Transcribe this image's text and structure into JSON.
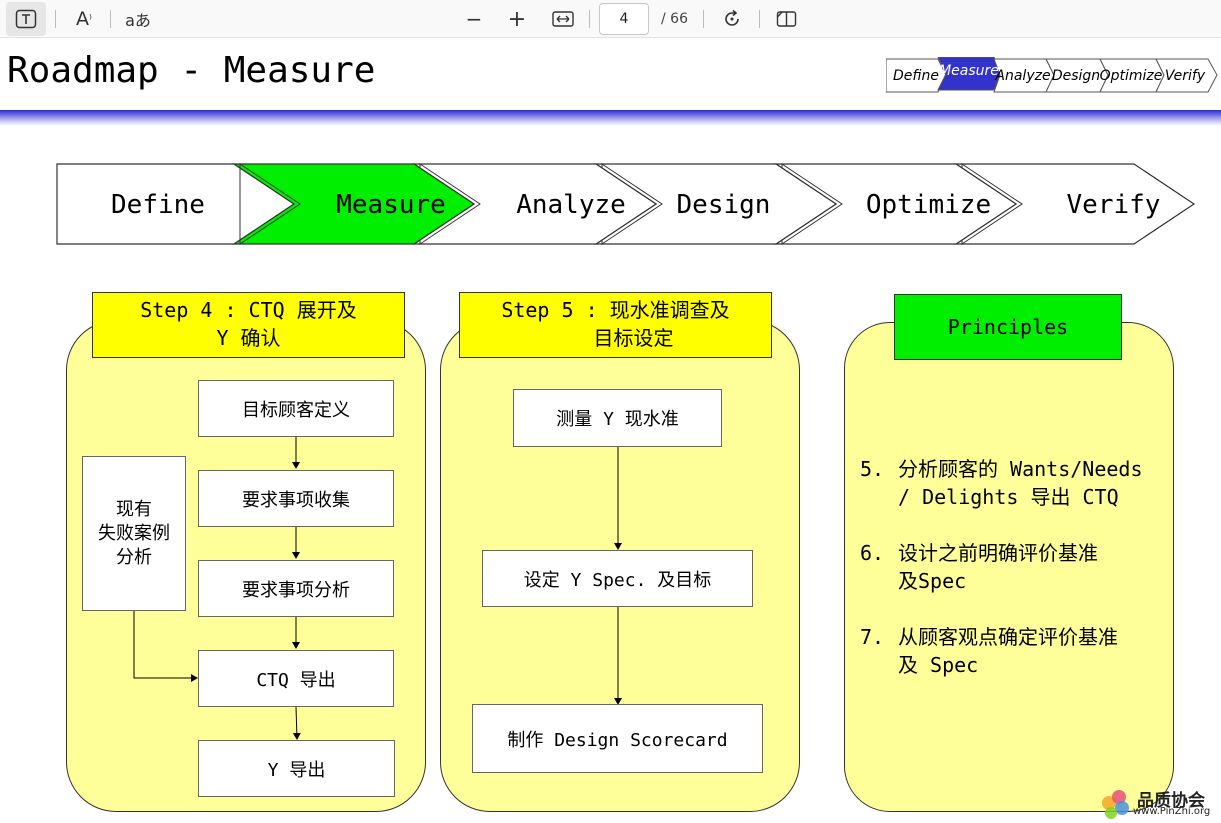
{
  "toolbar": {
    "text_tool_icon": "T",
    "read_aloud_icon": "A",
    "translate_icon": "aあ",
    "zoom_out_icon": "−",
    "zoom_in_icon": "+",
    "fit_width_icon": "↔",
    "current_page": "4",
    "total_pages": "/ 66",
    "rotate_icon": "rotate-icon",
    "two_page_icon": "page-view-icon"
  },
  "slide": {
    "title": "Roadmap - Measure",
    "mini_nav": [
      "Define",
      "Measure",
      "Analyze",
      "Design",
      "Optimize",
      "Verify"
    ],
    "big_nav": [
      "Define",
      "Measure",
      "Analyze",
      "Design",
      "Optimize",
      "Verify"
    ],
    "active_step": "Measure",
    "colors": {
      "active": "#00ee00",
      "mini_active": "#3333cc",
      "panel": "#ffff99",
      "header": "#ffff00",
      "banner": "#2a2ad6"
    }
  },
  "step4": {
    "header_line1": "Step 4 : CTQ 展开及",
    "header_line2": "Y 确认",
    "boxes": [
      "目标顾客定义",
      "要求事项收集",
      "要求事项分析",
      "CTQ 导出",
      "Y 导出"
    ],
    "side_line1": "现有",
    "side_line2": "失败案例",
    "side_line3": "分析"
  },
  "step5": {
    "header_line1": "Step 5 : 现水准调查及",
    "header_line2": "目标设定",
    "boxes": [
      "测量 Y 现水准",
      "设定 Y Spec. 及目标",
      "制作 Design Scorecard"
    ]
  },
  "principles": {
    "title": "Principles",
    "items": [
      {
        "num": "5.",
        "line1": "分析顾客的 Wants/Needs",
        "line2": "/ Delights 导出 CTQ"
      },
      {
        "num": "6.",
        "line1": "设计之前明确评价基准",
        "line2": "及Spec"
      },
      {
        "num": "7.",
        "line1": "从顾客观点确定评价基准",
        "line2": "及 Spec"
      }
    ]
  },
  "logo": {
    "name": "品质协会",
    "url": "www.PinZhi.org"
  }
}
